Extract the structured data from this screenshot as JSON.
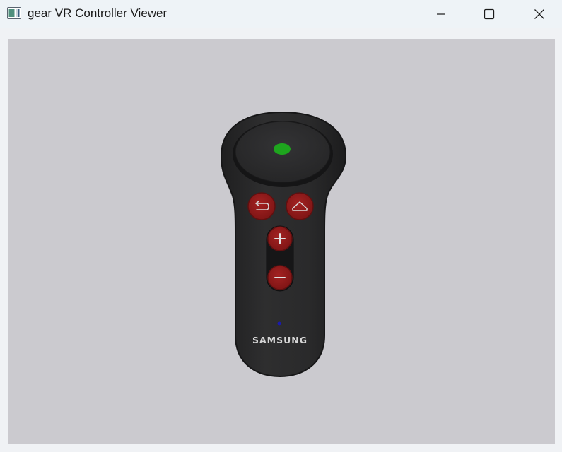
{
  "window": {
    "title": "gear VR Controller Viewer",
    "controls": {
      "minimize": "minimize",
      "maximize": "maximize",
      "close": "close"
    }
  },
  "viewer": {
    "background_color": "#cbcacf",
    "controller": {
      "body_color": "#2a2a2b",
      "button_color": "#8e1818",
      "touchpad_indicator_color": "#1ea51e",
      "led_color": "#1a1ab0",
      "brand": "SAMSUNG",
      "buttons": {
        "back": "back-arrow-icon",
        "home": "home-icon",
        "volume_up": "+",
        "volume_down": "−"
      }
    }
  }
}
